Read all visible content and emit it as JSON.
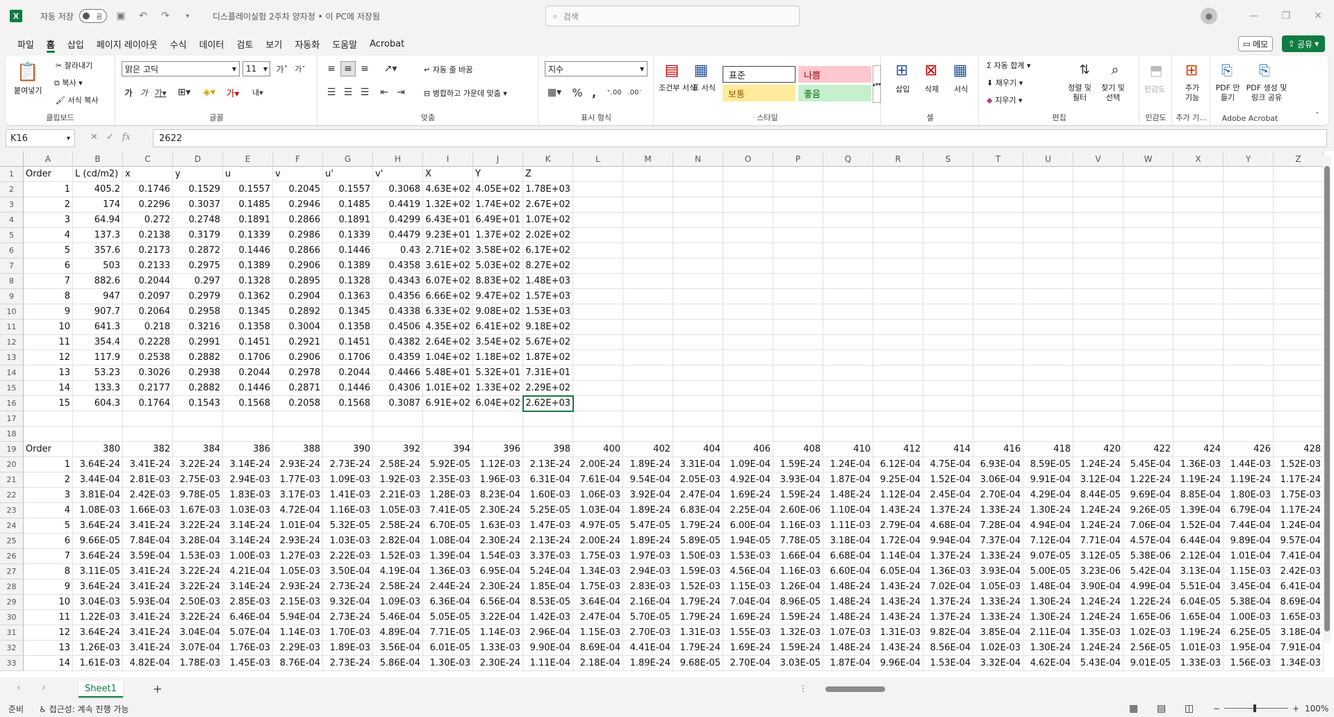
{
  "titlebar": {
    "autosave_label": "자동 저장",
    "autosave_state": "끔",
    "doc_title": "디스플레이실험 2주차 양자정 • 이 PC에 저장됨",
    "search_placeholder": "검색"
  },
  "menu": [
    "파일",
    "홈",
    "삽입",
    "페이지 레이아웃",
    "수식",
    "데이터",
    "검토",
    "보기",
    "자동화",
    "도움말",
    "Acrobat"
  ],
  "menu_active": "홈",
  "memo_label": "메모",
  "share_label": "공유",
  "ribbon": {
    "clipboard": {
      "paste": "붙여넣기",
      "cut": "잘라내기",
      "copy": "복사",
      "format_painter": "서식 복사",
      "label": "클립보드"
    },
    "font": {
      "name": "맑은 고딕",
      "size": "11",
      "label": "글꼴"
    },
    "align": {
      "wrap": "자동 줄 바꿈",
      "merge": "병합하고 가운데 맞춤",
      "label": "맞춤"
    },
    "number": {
      "format": "지수",
      "label": "표시 형식"
    },
    "styles": {
      "cond": "조건부 서식",
      "table": "표 서식",
      "normal": "표준",
      "bad": "나쁨",
      "neutral": "보통",
      "good": "좋음",
      "label": "스타일"
    },
    "cells": {
      "insert": "삽입",
      "delete": "삭제",
      "format": "서식",
      "label": "셀"
    },
    "edit": {
      "autosum": "자동 합계",
      "fill": "채우기",
      "clear": "지우기",
      "sort": "정렬 및 필터",
      "find": "찾기 및 선택",
      "label": "편집"
    },
    "sensitivity": {
      "btn": "민감도",
      "label": "민감도"
    },
    "addins": {
      "btn": "추가 기능",
      "label": "추가 기..."
    },
    "acrobat": {
      "create": "PDF 만들기",
      "share": "PDF 생성 및 링크 공유",
      "label": "Adobe Acrobat"
    }
  },
  "namebox": "K16",
  "formula": "2622",
  "columns": [
    "A",
    "B",
    "C",
    "D",
    "E",
    "F",
    "G",
    "H",
    "I",
    "J",
    "K",
    "L",
    "M",
    "N",
    "O",
    "P",
    "Q",
    "R",
    "S",
    "T",
    "U",
    "V",
    "W",
    "X",
    "Y",
    "Z"
  ],
  "rows": [
    {
      "n": "1",
      "c": [
        "Order",
        "L (cd/m2)",
        "x",
        "y",
        "u",
        "v",
        "u'",
        "v'",
        "X",
        "Y",
        "Z"
      ]
    },
    {
      "n": "2",
      "c": [
        "1",
        "405.2",
        "0.1746",
        "0.1529",
        "0.1557",
        "0.2045",
        "0.1557",
        "0.3068",
        "4.63E+02",
        "4.05E+02",
        "1.78E+03"
      ]
    },
    {
      "n": "3",
      "c": [
        "2",
        "174",
        "0.2296",
        "0.3037",
        "0.1485",
        "0.2946",
        "0.1485",
        "0.4419",
        "1.32E+02",
        "1.74E+02",
        "2.67E+02"
      ]
    },
    {
      "n": "4",
      "c": [
        "3",
        "64.94",
        "0.272",
        "0.2748",
        "0.1891",
        "0.2866",
        "0.1891",
        "0.4299",
        "6.43E+01",
        "6.49E+01",
        "1.07E+02"
      ]
    },
    {
      "n": "5",
      "c": [
        "4",
        "137.3",
        "0.2138",
        "0.3179",
        "0.1339",
        "0.2986",
        "0.1339",
        "0.4479",
        "9.23E+01",
        "1.37E+02",
        "2.02E+02"
      ]
    },
    {
      "n": "6",
      "c": [
        "5",
        "357.6",
        "0.2173",
        "0.2872",
        "0.1446",
        "0.2866",
        "0.1446",
        "0.43",
        "2.71E+02",
        "3.58E+02",
        "6.17E+02"
      ]
    },
    {
      "n": "7",
      "c": [
        "6",
        "503",
        "0.2133",
        "0.2975",
        "0.1389",
        "0.2906",
        "0.1389",
        "0.4358",
        "3.61E+02",
        "5.03E+02",
        "8.27E+02"
      ]
    },
    {
      "n": "8",
      "c": [
        "7",
        "882.6",
        "0.2044",
        "0.297",
        "0.1328",
        "0.2895",
        "0.1328",
        "0.4343",
        "6.07E+02",
        "8.83E+02",
        "1.48E+03"
      ]
    },
    {
      "n": "9",
      "c": [
        "8",
        "947",
        "0.2097",
        "0.2979",
        "0.1362",
        "0.2904",
        "0.1363",
        "0.4356",
        "6.66E+02",
        "9.47E+02",
        "1.57E+03"
      ]
    },
    {
      "n": "10",
      "c": [
        "9",
        "907.7",
        "0.2064",
        "0.2958",
        "0.1345",
        "0.2892",
        "0.1345",
        "0.4338",
        "6.33E+02",
        "9.08E+02",
        "1.53E+03"
      ]
    },
    {
      "n": "11",
      "c": [
        "10",
        "641.3",
        "0.218",
        "0.3216",
        "0.1358",
        "0.3004",
        "0.1358",
        "0.4506",
        "4.35E+02",
        "6.41E+02",
        "9.18E+02"
      ]
    },
    {
      "n": "12",
      "c": [
        "11",
        "354.4",
        "0.2228",
        "0.2991",
        "0.1451",
        "0.2921",
        "0.1451",
        "0.4382",
        "2.64E+02",
        "3.54E+02",
        "5.67E+02"
      ]
    },
    {
      "n": "13",
      "c": [
        "12",
        "117.9",
        "0.2538",
        "0.2882",
        "0.1706",
        "0.2906",
        "0.1706",
        "0.4359",
        "1.04E+02",
        "1.18E+02",
        "1.87E+02"
      ]
    },
    {
      "n": "14",
      "c": [
        "13",
        "53.23",
        "0.3026",
        "0.2938",
        "0.2044",
        "0.2978",
        "0.2044",
        "0.4466",
        "5.48E+01",
        "5.32E+01",
        "7.31E+01"
      ]
    },
    {
      "n": "15",
      "c": [
        "14",
        "133.3",
        "0.2177",
        "0.2882",
        "0.1446",
        "0.2871",
        "0.1446",
        "0.4306",
        "1.01E+02",
        "1.33E+02",
        "2.29E+02"
      ]
    },
    {
      "n": "16",
      "c": [
        "15",
        "604.3",
        "0.1764",
        "0.1543",
        "0.1568",
        "0.2058",
        "0.1568",
        "0.3087",
        "6.91E+02",
        "6.04E+02",
        "2.62E+03"
      ]
    },
    {
      "n": "17",
      "c": []
    },
    {
      "n": "18",
      "c": []
    },
    {
      "n": "19",
      "c": [
        "Order",
        "380",
        "382",
        "384",
        "386",
        "388",
        "390",
        "392",
        "394",
        "396",
        "398",
        "400",
        "402",
        "404",
        "406",
        "408",
        "410",
        "412",
        "414",
        "416",
        "418",
        "420",
        "422",
        "424",
        "426",
        "428"
      ]
    },
    {
      "n": "20",
      "c": [
        "1",
        "3.64E-24",
        "3.41E-24",
        "3.22E-24",
        "3.14E-24",
        "2.93E-24",
        "2.73E-24",
        "2.58E-24",
        "5.92E-05",
        "1.12E-03",
        "2.13E-24",
        "2.00E-24",
        "1.89E-24",
        "3.31E-04",
        "1.09E-04",
        "1.59E-24",
        "1.24E-04",
        "6.12E-04",
        "4.75E-04",
        "6.93E-04",
        "8.59E-05",
        "1.24E-24",
        "5.45E-04",
        "1.36E-03",
        "1.44E-03",
        "1.52E-03"
      ]
    },
    {
      "n": "21",
      "c": [
        "2",
        "3.44E-04",
        "2.81E-03",
        "2.75E-03",
        "2.94E-03",
        "1.77E-03",
        "1.09E-03",
        "1.92E-03",
        "2.35E-03",
        "1.96E-03",
        "6.31E-04",
        "7.61E-04",
        "9.54E-04",
        "2.05E-03",
        "4.92E-04",
        "3.93E-04",
        "1.87E-04",
        "9.25E-04",
        "1.52E-04",
        "3.06E-04",
        "9.91E-04",
        "3.12E-04",
        "1.22E-24",
        "1.19E-24",
        "1.19E-24",
        "1.17E-24"
      ]
    },
    {
      "n": "22",
      "c": [
        "3",
        "3.81E-04",
        "2.42E-03",
        "9.78E-05",
        "1.83E-03",
        "3.17E-03",
        "1.41E-03",
        "2.21E-03",
        "1.28E-03",
        "8.23E-04",
        "1.60E-03",
        "1.06E-03",
        "3.92E-04",
        "2.47E-04",
        "1.69E-24",
        "1.59E-24",
        "1.48E-24",
        "1.12E-04",
        "2.45E-04",
        "2.70E-04",
        "4.29E-04",
        "8.44E-05",
        "9.69E-04",
        "8.85E-04",
        "1.80E-03",
        "1.75E-03"
      ]
    },
    {
      "n": "23",
      "c": [
        "4",
        "1.08E-03",
        "1.66E-03",
        "1.67E-03",
        "1.03E-03",
        "4.72E-04",
        "1.16E-03",
        "1.05E-03",
        "7.41E-05",
        "2.30E-24",
        "5.25E-05",
        "1.03E-04",
        "1.89E-24",
        "6.83E-04",
        "2.25E-04",
        "2.60E-06",
        "1.10E-04",
        "1.43E-24",
        "1.37E-24",
        "1.33E-24",
        "1.30E-24",
        "1.24E-24",
        "9.26E-05",
        "1.39E-04",
        "6.79E-04",
        "1.17E-24"
      ]
    },
    {
      "n": "24",
      "c": [
        "5",
        "3.64E-24",
        "3.41E-24",
        "3.22E-24",
        "3.14E-24",
        "1.01E-04",
        "5.32E-05",
        "2.58E-24",
        "6.70E-05",
        "1.63E-03",
        "1.47E-03",
        "4.97E-05",
        "5.47E-05",
        "1.79E-24",
        "6.00E-04",
        "1.16E-03",
        "1.11E-03",
        "2.79E-04",
        "4.68E-04",
        "7.28E-04",
        "4.94E-04",
        "1.24E-24",
        "7.06E-04",
        "1.52E-04",
        "7.44E-04",
        "1.24E-04"
      ]
    },
    {
      "n": "25",
      "c": [
        "6",
        "9.66E-05",
        "7.84E-04",
        "3.28E-04",
        "3.14E-24",
        "2.93E-24",
        "1.03E-03",
        "2.82E-04",
        "1.08E-04",
        "2.30E-24",
        "2.13E-24",
        "2.00E-24",
        "1.89E-24",
        "5.89E-05",
        "1.94E-05",
        "7.78E-05",
        "3.18E-04",
        "1.72E-04",
        "9.94E-04",
        "7.37E-04",
        "7.12E-04",
        "7.71E-04",
        "4.57E-04",
        "6.44E-04",
        "9.89E-04",
        "9.57E-04"
      ]
    },
    {
      "n": "26",
      "c": [
        "7",
        "3.64E-24",
        "3.59E-04",
        "1.53E-03",
        "1.00E-03",
        "1.27E-03",
        "2.22E-03",
        "1.52E-03",
        "1.39E-04",
        "1.54E-03",
        "3.37E-03",
        "1.75E-03",
        "1.97E-03",
        "1.50E-03",
        "1.53E-03",
        "1.66E-04",
        "6.68E-04",
        "1.14E-04",
        "1.37E-24",
        "1.33E-24",
        "9.07E-05",
        "3.12E-05",
        "5.38E-06",
        "2.12E-04",
        "1.01E-04",
        "7.41E-04"
      ]
    },
    {
      "n": "27",
      "c": [
        "8",
        "3.11E-05",
        "3.41E-24",
        "3.22E-24",
        "4.21E-04",
        "1.05E-03",
        "3.50E-04",
        "4.19E-04",
        "1.36E-03",
        "6.95E-04",
        "5.24E-04",
        "1.34E-03",
        "2.94E-03",
        "1.59E-03",
        "4.56E-04",
        "1.16E-03",
        "6.60E-04",
        "6.05E-04",
        "1.36E-03",
        "3.93E-04",
        "5.00E-05",
        "3.23E-06",
        "5.42E-04",
        "3.13E-04",
        "1.15E-03",
        "2.42E-03"
      ]
    },
    {
      "n": "28",
      "c": [
        "9",
        "3.64E-24",
        "3.41E-24",
        "3.22E-24",
        "3.14E-24",
        "2.93E-24",
        "2.73E-24",
        "2.58E-24",
        "2.44E-24",
        "2.30E-24",
        "1.85E-04",
        "1.75E-03",
        "2.83E-03",
        "1.52E-03",
        "1.15E-03",
        "1.26E-04",
        "1.48E-24",
        "1.43E-24",
        "7.02E-04",
        "1.05E-03",
        "1.48E-04",
        "3.90E-04",
        "4.99E-04",
        "5.51E-04",
        "3.45E-04",
        "6.41E-04"
      ]
    },
    {
      "n": "29",
      "c": [
        "10",
        "3.04E-03",
        "5.93E-04",
        "2.50E-03",
        "2.85E-03",
        "2.15E-03",
        "9.32E-04",
        "1.09E-03",
        "6.36E-04",
        "6.56E-04",
        "8.53E-05",
        "3.64E-04",
        "2.16E-04",
        "1.79E-24",
        "7.04E-04",
        "8.96E-05",
        "1.48E-24",
        "1.43E-24",
        "1.37E-24",
        "1.33E-24",
        "1.30E-24",
        "1.24E-24",
        "1.22E-24",
        "6.04E-05",
        "5.38E-04",
        "8.69E-04"
      ]
    },
    {
      "n": "30",
      "c": [
        "11",
        "1.22E-03",
        "3.41E-24",
        "3.22E-24",
        "6.46E-04",
        "5.94E-04",
        "2.73E-24",
        "5.46E-04",
        "5.05E-05",
        "3.22E-04",
        "1.42E-03",
        "2.47E-04",
        "5.70E-05",
        "1.79E-24",
        "1.69E-24",
        "1.59E-24",
        "1.48E-24",
        "1.43E-24",
        "1.37E-24",
        "1.33E-24",
        "1.30E-24",
        "1.24E-24",
        "1.65E-06",
        "1.65E-04",
        "1.00E-03",
        "1.65E-03"
      ]
    },
    {
      "n": "31",
      "c": [
        "12",
        "3.64E-24",
        "3.41E-24",
        "3.04E-04",
        "5.07E-04",
        "1.14E-03",
        "1.70E-03",
        "4.89E-04",
        "7.71E-05",
        "1.14E-03",
        "2.96E-04",
        "1.15E-03",
        "2.70E-03",
        "1.31E-03",
        "1.55E-03",
        "1.32E-03",
        "1.07E-03",
        "1.31E-03",
        "9.82E-04",
        "3.85E-04",
        "2.11E-04",
        "1.35E-03",
        "1.02E-03",
        "1.19E-24",
        "6.25E-05",
        "3.18E-04"
      ]
    },
    {
      "n": "32",
      "c": [
        "13",
        "1.26E-03",
        "3.41E-24",
        "3.07E-04",
        "1.76E-03",
        "2.29E-03",
        "1.89E-03",
        "3.56E-04",
        "6.01E-05",
        "1.33E-03",
        "9.90E-04",
        "8.69E-04",
        "4.41E-04",
        "1.79E-24",
        "1.69E-24",
        "1.59E-24",
        "1.48E-24",
        "1.43E-24",
        "8.56E-04",
        "1.02E-03",
        "1.30E-24",
        "1.24E-24",
        "2.56E-05",
        "1.01E-03",
        "1.95E-04",
        "7.91E-04"
      ]
    },
    {
      "n": "33",
      "c": [
        "14",
        "1.61E-03",
        "4.82E-04",
        "1.78E-03",
        "1.45E-03",
        "8.76E-04",
        "2.73E-24",
        "5.86E-04",
        "1.30E-03",
        "2.30E-24",
        "1.11E-04",
        "2.18E-04",
        "1.89E-24",
        "9.68E-05",
        "2.70E-04",
        "3.03E-05",
        "1.87E-04",
        "9.96E-04",
        "1.53E-04",
        "3.32E-04",
        "4.62E-04",
        "5.43E-04",
        "9.01E-05",
        "1.33E-03",
        "1.56E-03",
        "1.34E-03"
      ]
    }
  ],
  "sheet_tab": "Sheet1",
  "status": {
    "ready": "준비",
    "accessibility": "접근성: 계속 진행 가능",
    "zoom": "100%"
  }
}
